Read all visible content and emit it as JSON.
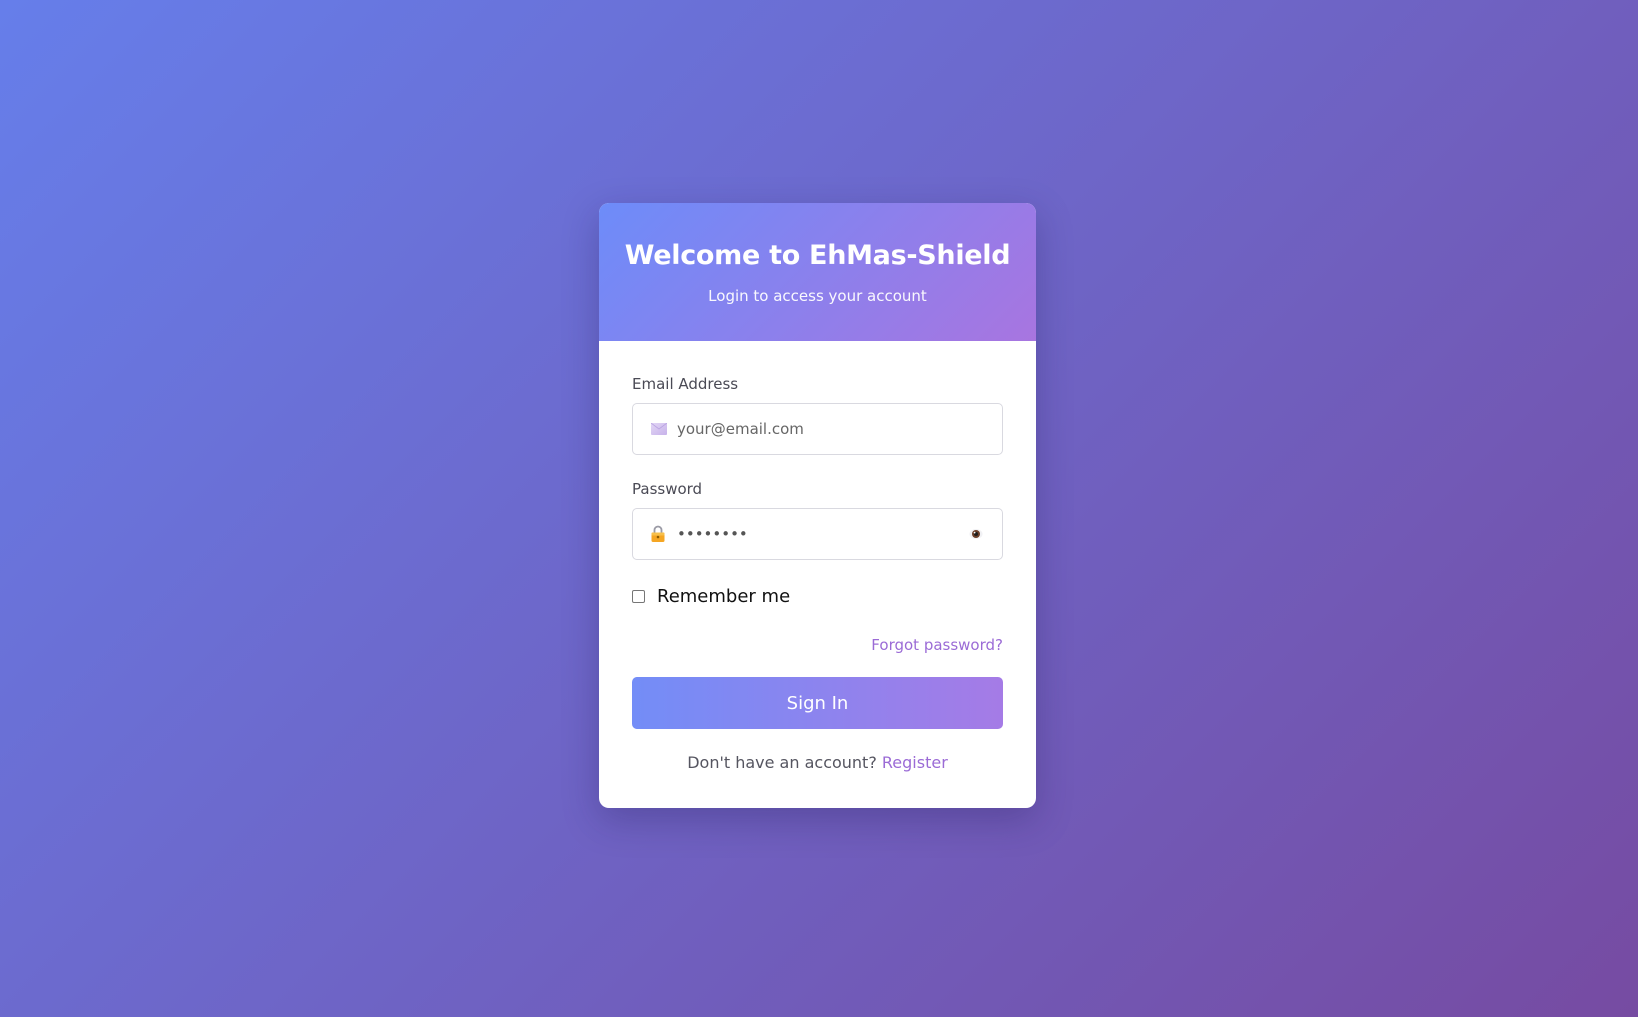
{
  "header": {
    "title": "Welcome to EhMas-Shield",
    "subtitle": "Login to access your account"
  },
  "email": {
    "label": "Email Address",
    "placeholder": "your@email.com",
    "icon": "envelope-icon"
  },
  "password": {
    "label": "Password",
    "value": "••••••••",
    "icon": "lock-icon",
    "toggle_icon": "eye-icon"
  },
  "remember": {
    "label": "Remember me",
    "checked": false
  },
  "forgot": {
    "label": "Forgot password?"
  },
  "signin": {
    "label": "Sign In"
  },
  "register": {
    "prompt": "Don't have an account?",
    "link": "Register"
  },
  "colors": {
    "background_start": "#667eea",
    "background_end": "#764ba2",
    "accent": "#9b6bd6"
  }
}
